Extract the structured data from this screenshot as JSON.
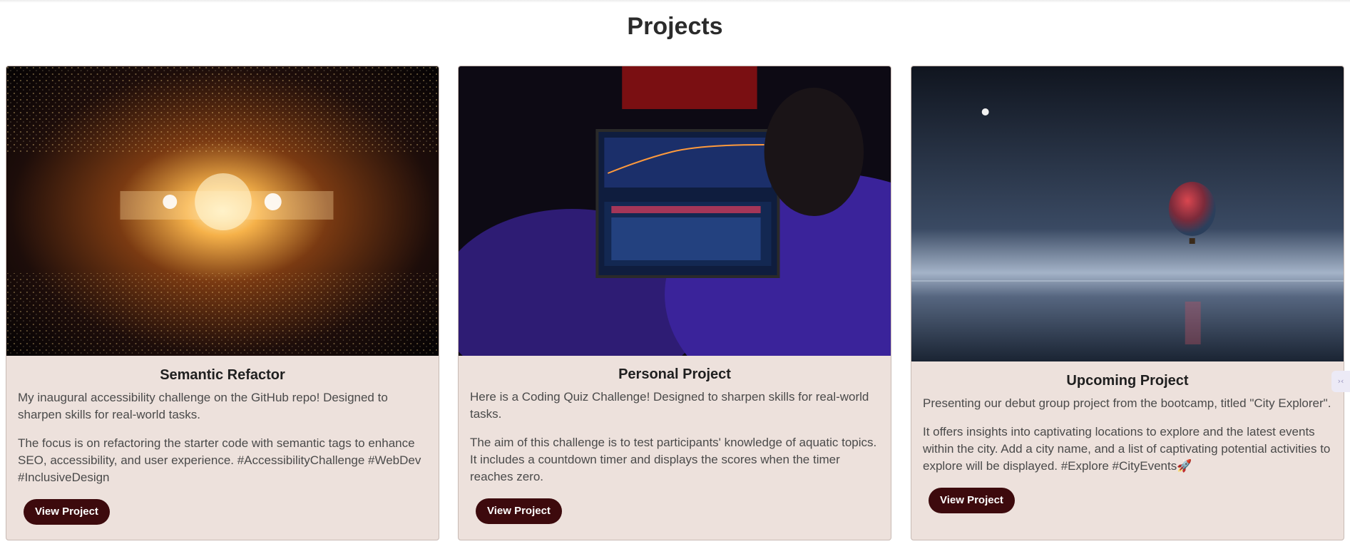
{
  "section": {
    "title": "Projects"
  },
  "cards": [
    {
      "image_alt": "Tunnel of golden light particles",
      "title": "Semantic Refactor",
      "paragraph1": "My inaugural accessibility challenge on the GitHub repo! Designed to sharpen skills for real-world tasks.",
      "paragraph2": "The focus is on refactoring the starter code with semantic tags to enhance SEO, accessibility, and user experience. #AccessibilityChallenge #WebDev #InclusiveDesign",
      "button": "View Project"
    },
    {
      "image_alt": "People looking at a laptop with an audio mixer interface",
      "title": "Personal Project",
      "paragraph1": "Here is a Coding Quiz Challenge! Designed to sharpen skills for real-world tasks.",
      "paragraph2": "The aim of this challenge is to test participants' knowledge of aquatic topics. It includes a countdown timer and displays the scores when the timer reaches zero.",
      "button": "View Project"
    },
    {
      "image_alt": "Hot air balloon over a calm sea at night",
      "title": "Upcoming Project",
      "paragraph1": "Presenting our debut group project from the bootcamp, titled \"City Explorer\".",
      "paragraph2": "It offers insights into captivating locations to explore and the latest events within the city. Add a city name, and a list of captivating potential activities to explore will be displayed. #Explore #CityEvents🚀",
      "button": "View Project"
    }
  ],
  "colors": {
    "card_bg": "#ede1dc",
    "button_bg": "#3d0a0d",
    "button_text": "#ffffff"
  },
  "side_tab": {
    "label": "›‹"
  }
}
